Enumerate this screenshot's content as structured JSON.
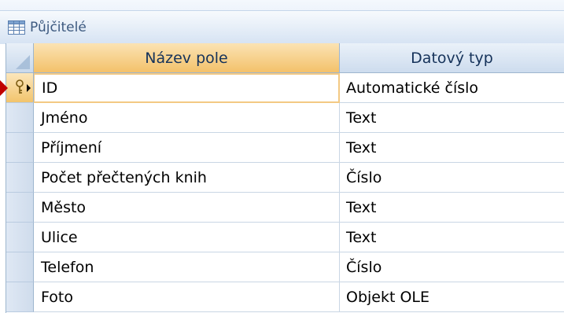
{
  "tab": {
    "title": "Půjčitelé",
    "icon": "table-icon"
  },
  "grid": {
    "columns": [
      "Název pole",
      "Datový typ"
    ],
    "rows": [
      {
        "field": "ID",
        "type": "Automatické číslo",
        "primary_key": true,
        "current": true
      },
      {
        "field": "Jméno",
        "type": "Text"
      },
      {
        "field": "Příjmení",
        "type": "Text"
      },
      {
        "field": "Počet přečtených knih",
        "type": "Číslo"
      },
      {
        "field": "Město",
        "type": "Text"
      },
      {
        "field": "Ulice",
        "type": "Text"
      },
      {
        "field": "Telefon",
        "type": "Číslo"
      },
      {
        "field": "Foto",
        "type": "Objekt OLE"
      }
    ]
  },
  "colors": {
    "selected_header": "#f3c16a",
    "pointer_arrow": "#c00000",
    "header_text": "#15325a"
  }
}
